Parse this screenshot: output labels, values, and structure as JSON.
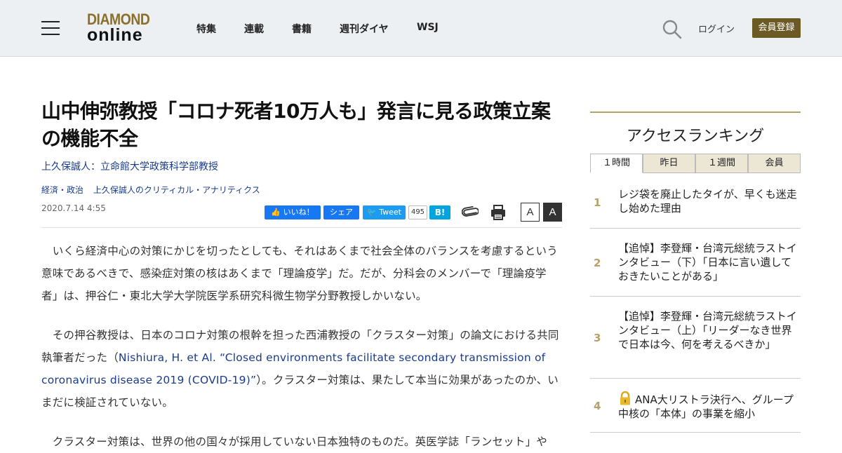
{
  "header": {
    "logo_line1": "DIAMOND",
    "logo_line2": "online",
    "nav": [
      "特集",
      "連載",
      "書籍",
      "週刊ダイヤ",
      "WSJ"
    ],
    "login": "ログイン",
    "register": "会員登録",
    "brand_color": "#6b5a24"
  },
  "article": {
    "title": "山中伸弥教授「コロナ死者10万人も」発言に見る政策立案の機能不全",
    "author": "上久保誠人：立命館大学政策科学部教授",
    "categories": [
      "経済・政治",
      "上久保誠人のクリティカル・アナリティクス"
    ],
    "date": "2020.7.14 4:55",
    "social": {
      "fb_like": "いいね！",
      "fb_share": "シェア",
      "tweet": "Tweet",
      "tweet_count": "495",
      "hatena": "B!"
    },
    "font_small": "A",
    "font_large": "A",
    "paragraphs": {
      "p1": "　いくら経済中心の対策にかじを切ったとしても、それはあくまで社会全体のバランスを考慮するという意味であるべきで、感染症対策の核はあくまで「理論疫学」だ。だが、分科会のメンバーで「理論疫学者」は、押谷仁・東北大学大学院医学系研究科微生物学分野教授しかいない。",
      "p2_before": "　その押谷教授は、日本のコロナ対策の根幹を担った西浦教授の「クラスター対策」の論文における共同執筆者だった（",
      "p2_link": "Nishiura, H. et Al. “Closed environments facilitate secondary transmission of coronavirus disease 2019 (COVID-19)”",
      "p2_after": "）。クラスター対策は、果たして本当に効果があったのか、いまだに検証されていない。",
      "p3": "　クラスター対策は、世界の他の国々が採用していない日本独特のものだ。英医学誌「ランセット」や"
    }
  },
  "ranking": {
    "title": "アクセスランキング",
    "tabs": [
      "１時間",
      "昨日",
      "１週間",
      "会員"
    ],
    "items": [
      {
        "rank": "1",
        "text": "レジ袋を廃止したタイが、早くも迷走し始めた理由",
        "locked": false
      },
      {
        "rank": "2",
        "text": "【追悼】李登輝・台湾元総統ラストインタビュー（下）「日本に言い遺しておきたいことがある」",
        "locked": false
      },
      {
        "rank": "3",
        "text": "【追悼】李登輝・台湾元総統ラストインタビュー（上）「リーダーなき世界で日本は今、何を考えるべきか」",
        "locked": false
      },
      {
        "rank": "4",
        "text": "ANA大リストラ決行へ、グループ中核の「本体」の事業を縮小",
        "locked": true
      }
    ],
    "accent_color": "#b8a06a"
  }
}
